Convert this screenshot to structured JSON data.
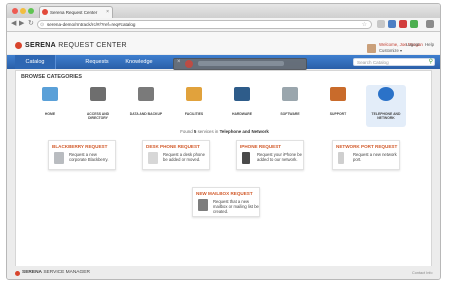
{
  "browser": {
    "tab_title": "Serena Request Center",
    "url": "serena-demo/rmtrack/rc/#/?ref=req#catalog",
    "close_glyph": "×",
    "back_glyph": "◀",
    "forward_glyph": "▶",
    "reload_glyph": "↻",
    "star_glyph": "☆",
    "url_glyph": "⊙"
  },
  "app": {
    "brand_prefix": "SERENA",
    "brand_name": "REQUEST CENTER",
    "welcome": "Welcome, Joe Morgan",
    "user_menu": "Customize ▾",
    "logout": "Logout",
    "help": "Help"
  },
  "nav": {
    "tabs": [
      "Catalog",
      "Requests",
      "Knowledge"
    ],
    "search_placeholder": "Search Catalog",
    "search_glyph": "⚲"
  },
  "mediabar": {
    "close_glyph": "×"
  },
  "catalog": {
    "section_title": "BROWSE CATEGORIES",
    "categories": [
      {
        "label": "HOME",
        "icon": "house-icon",
        "color": "#5aa0d8"
      },
      {
        "label": "ACCESS AND DIRECTORY",
        "icon": "users-icon",
        "color": "#6e6e6e"
      },
      {
        "label": "DATA AND BACKUP",
        "icon": "database-icon",
        "color": "#7a7a7a"
      },
      {
        "label": "FACILITIES",
        "icon": "tools-icon",
        "color": "#e1a23c"
      },
      {
        "label": "HARDWARE",
        "icon": "monitor-icon",
        "color": "#2e5c8a"
      },
      {
        "label": "SOFTWARE",
        "icon": "software-icon",
        "color": "#9aa6ad"
      },
      {
        "label": "SUPPORT",
        "icon": "headset-icon",
        "color": "#c96b2b"
      },
      {
        "label": "TELEPHONE AND NETWORK",
        "icon": "globe-icon",
        "color": "#2b72c8"
      }
    ],
    "found_prefix": "Found",
    "found_count": "5",
    "found_middle": "services in",
    "found_category": "Telephone and Network",
    "services": [
      {
        "title": "BLACKBERRY REQUEST",
        "desc": "Request a new corporate Blackberry.",
        "icon": "blackberry-icon"
      },
      {
        "title": "DESK PHONE REQUEST",
        "desc": "Request a desk phone be added or moved.",
        "icon": "desk-phone-icon"
      },
      {
        "title": "IPHONE REQUEST",
        "desc": "Request your iPhone be added to our network.",
        "icon": "iphone-icon"
      },
      {
        "title": "NETWORK PORT REQUEST",
        "desc": "Request a new network port.",
        "icon": "network-port-icon"
      },
      {
        "title": "NEW MAILBOX REQUEST",
        "desc": "Request that a new mailbox or mailing list be created.",
        "icon": "mailbox-icon"
      }
    ]
  },
  "footer": {
    "brand_prefix": "SERENA",
    "brand_name": "SERVICE MANAGER",
    "contact": "Contact Info"
  }
}
